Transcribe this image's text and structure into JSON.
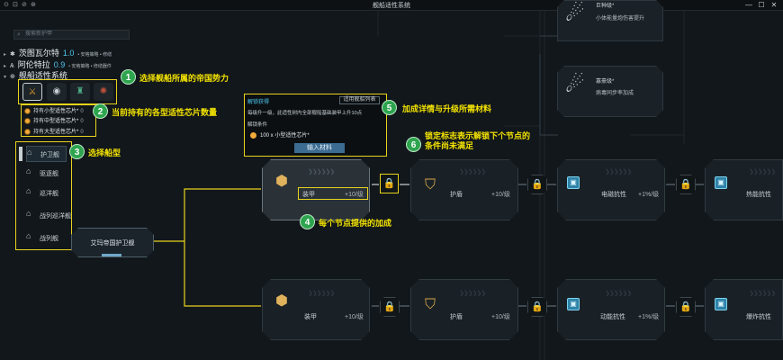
{
  "window": {
    "title": "舰船适性系统",
    "controls": {
      "minimize": "—",
      "maximize": "☐",
      "close": "✕"
    },
    "toolbar_icons": [
      "⊙",
      "⊘",
      "⊛"
    ]
  },
  "search": {
    "placeholder": "搜索新护甲"
  },
  "factions": [
    {
      "name": "茨图瓦尔特",
      "value": "1.0",
      "tags": "• 安格策略 • 修缮",
      "expanded": false
    },
    {
      "name": "阿伦特拉",
      "value": "0.9",
      "tags": "• 安格策略 • 修缮器件",
      "expanded": false
    },
    {
      "name": "舰船适性系统",
      "value": "",
      "tags": "",
      "expanded": true
    }
  ],
  "empire_icons": [
    {
      "name": "empire-1",
      "glyph": "⚔",
      "color": "#e8a32c"
    },
    {
      "name": "empire-2",
      "glyph": "◉",
      "color": "#c9d1d6"
    },
    {
      "name": "empire-3",
      "glyph": "♜",
      "color": "#4fb38a"
    },
    {
      "name": "empire-4",
      "glyph": "✺",
      "color": "#c0503c"
    }
  ],
  "chips": [
    {
      "prefix": "持有",
      "name": "小型适性芯片*",
      "count": "0"
    },
    {
      "prefix": "持有",
      "name": "中型适性芯片*",
      "count": "0"
    },
    {
      "prefix": "持有",
      "name": "大型适性芯片*",
      "count": "0"
    }
  ],
  "ship_types": [
    {
      "label": "护卫舰",
      "selected": true
    },
    {
      "label": "驱逐舰",
      "selected": false
    },
    {
      "label": "巡洋舰",
      "selected": false
    },
    {
      "label": "战列巡洋舰",
      "selected": false
    },
    {
      "label": "战列舰",
      "selected": false
    }
  ],
  "start_node": {
    "label": "艾玛帝国护卫舰"
  },
  "tooltip": {
    "title": "解锁获得",
    "button": "适用舰船列表",
    "desc": "每级升一级，此适性树内全部舰船基础装甲上升10点",
    "condition_title": "解锁条件",
    "requirement": "100 x 小型适性芯片*",
    "input_button": "输入材料"
  },
  "callouts": [
    {
      "num": "1",
      "text": "选择舰船所属的帝国势力"
    },
    {
      "num": "2",
      "text": "当前持有的各型适性芯片数量"
    },
    {
      "num": "3",
      "text": "选择船型"
    },
    {
      "num": "4",
      "text": "每个节点提供的加成"
    },
    {
      "num": "5",
      "text": "加成详情与升级所需材料"
    },
    {
      "num": "6",
      "text": "锁定标志表示解锁下个节点的条件尚未满足"
    }
  ],
  "row1": [
    {
      "label": "装甲",
      "rate": "+10/级"
    },
    {
      "label": "护盾",
      "rate": "+10/级"
    },
    {
      "label": "电磁抗性",
      "rate": "+1%/级"
    },
    {
      "label": "热能抗性",
      "rate": ""
    }
  ],
  "row2": [
    {
      "label": "装甲",
      "rate": "+10/级"
    },
    {
      "label": "护盾",
      "rate": "+10/级"
    },
    {
      "label": "动能抗性",
      "rate": "+1%/级"
    },
    {
      "label": "爆炸抗性",
      "rate": ""
    }
  ],
  "side_nodes": [
    {
      "title": "巨种级*",
      "desc": "小体能量炮伤害提升"
    },
    {
      "title": "寡豪级*",
      "desc": "病毒同步率加成"
    }
  ],
  "arrows_text": "❯❯❯❯❯❯"
}
